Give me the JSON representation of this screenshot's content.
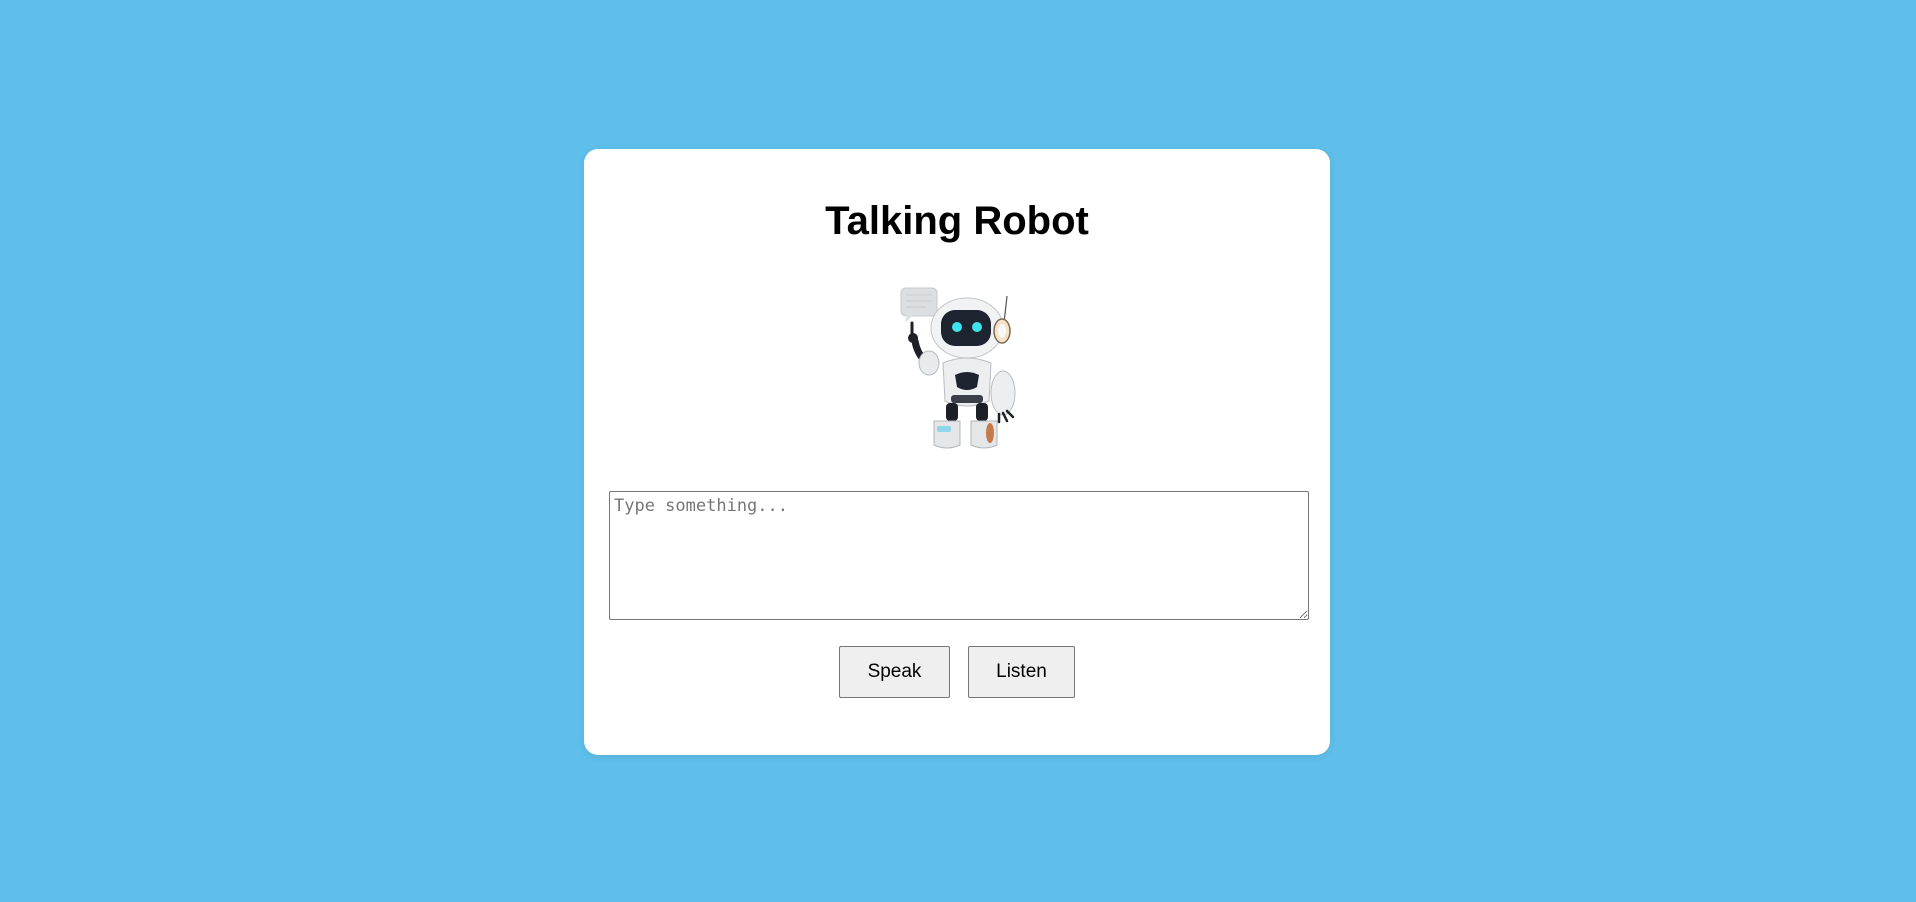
{
  "page": {
    "title": "Talking Robot"
  },
  "robot_image": {
    "icon": "robot-waving-icon"
  },
  "message_input": {
    "placeholder": "Type something...",
    "value": ""
  },
  "buttons": {
    "speak_label": "Speak",
    "listen_label": "Listen"
  },
  "colors": {
    "background": "#5fbfea",
    "card": "#ffffff",
    "robot_eyes": "#3ee3f0"
  }
}
